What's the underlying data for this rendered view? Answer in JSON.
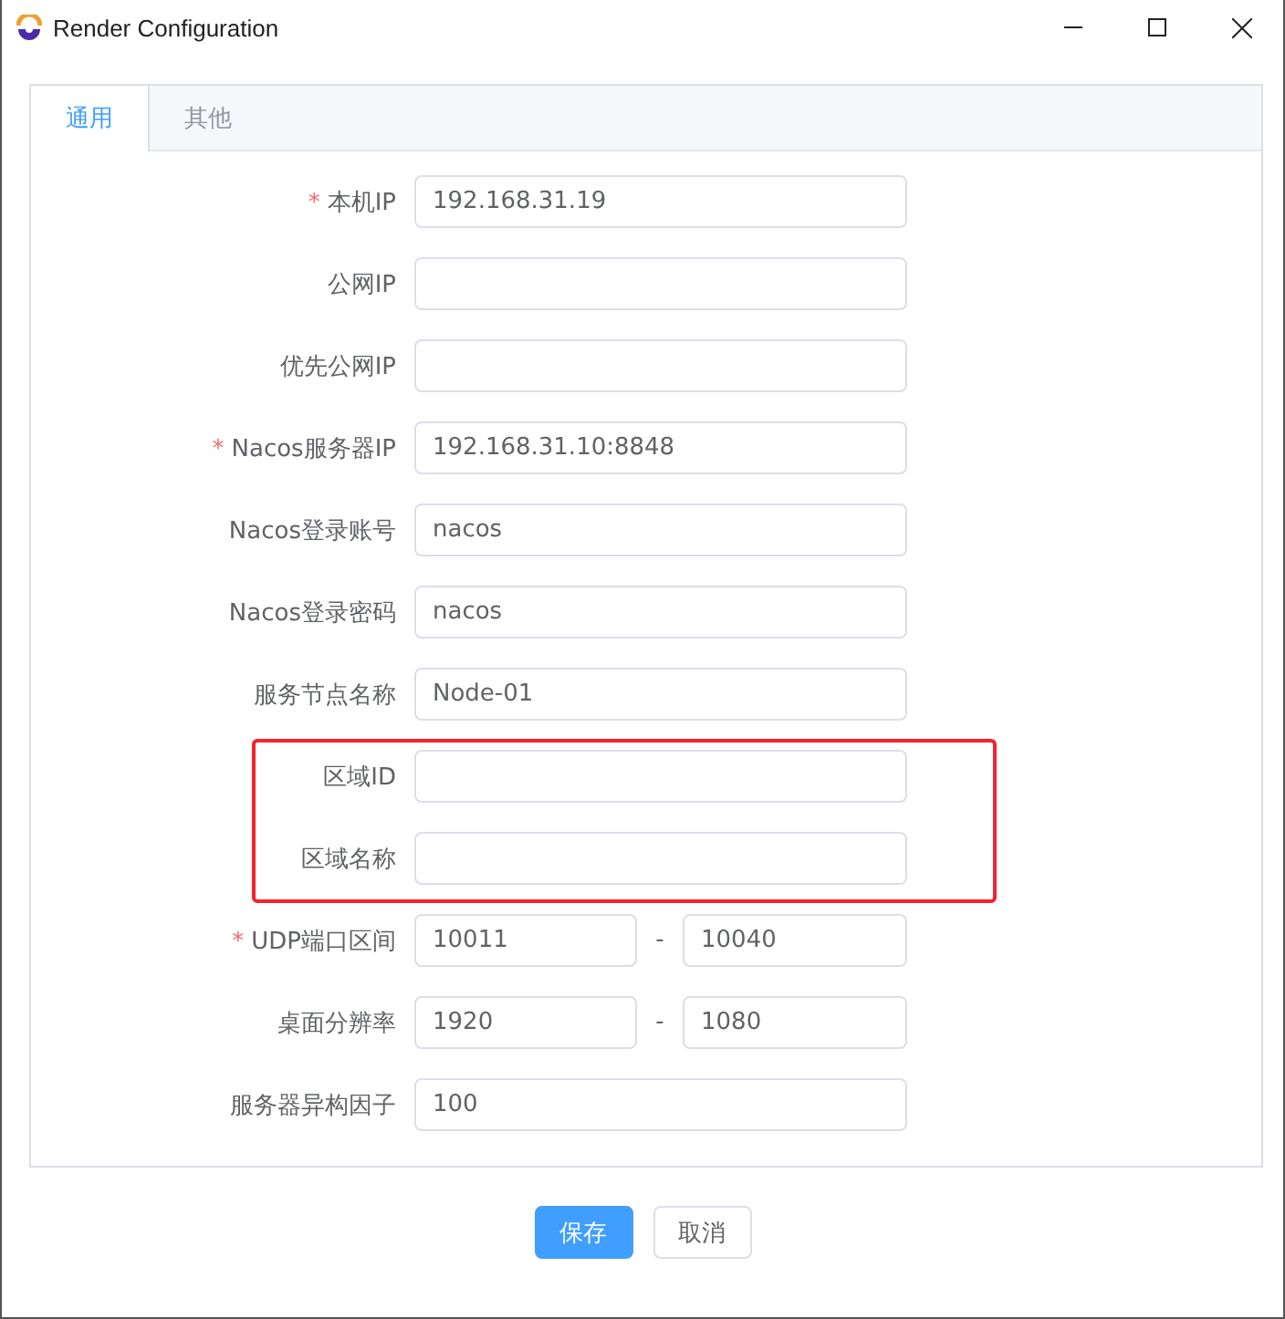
{
  "window": {
    "title": "Render Configuration"
  },
  "tabs": [
    {
      "label": "通用",
      "selected": true
    },
    {
      "label": "其他",
      "selected": false
    }
  ],
  "rows": [
    {
      "kind": "text",
      "asterisk": "*",
      "label": "本机IP",
      "value": "192.168.31.19",
      "highlighted": false
    },
    {
      "kind": "text",
      "label": "公网IP",
      "value": "",
      "highlighted": false
    },
    {
      "kind": "text",
      "label": "优先公网IP",
      "value": "",
      "highlighted": false
    },
    {
      "kind": "text",
      "asterisk": "*",
      "label": "Nacos服务器IP",
      "value": "192.168.31.10:8848",
      "highlighted": false
    },
    {
      "kind": "text",
      "label": "Nacos登录账号",
      "value": "nacos",
      "highlighted": false
    },
    {
      "kind": "text",
      "label": "Nacos登录密码",
      "value": "nacos",
      "highlighted": false
    },
    {
      "kind": "text",
      "label": "服务节点名称",
      "value": "Node-01",
      "highlighted": false
    },
    {
      "kind": "text",
      "label": "区域ID",
      "value": "",
      "highlighted": true
    },
    {
      "kind": "text",
      "label": "区域名称",
      "value": "",
      "highlighted": true
    },
    {
      "kind": "range",
      "asterisk": "*",
      "label": "UDP端口区间",
      "from": "10011",
      "separator": "-",
      "to": "10040",
      "highlighted": false
    },
    {
      "kind": "range",
      "label": "桌面分辨率",
      "from": "1920",
      "separator": "-",
      "to": "1080",
      "highlighted": false
    },
    {
      "kind": "text",
      "label": "服务器异构因子",
      "value": "100",
      "highlighted": false
    }
  ],
  "buttons": [
    {
      "label": "保存",
      "kind": "primary"
    },
    {
      "label": "取消",
      "kind": "default"
    }
  ]
}
